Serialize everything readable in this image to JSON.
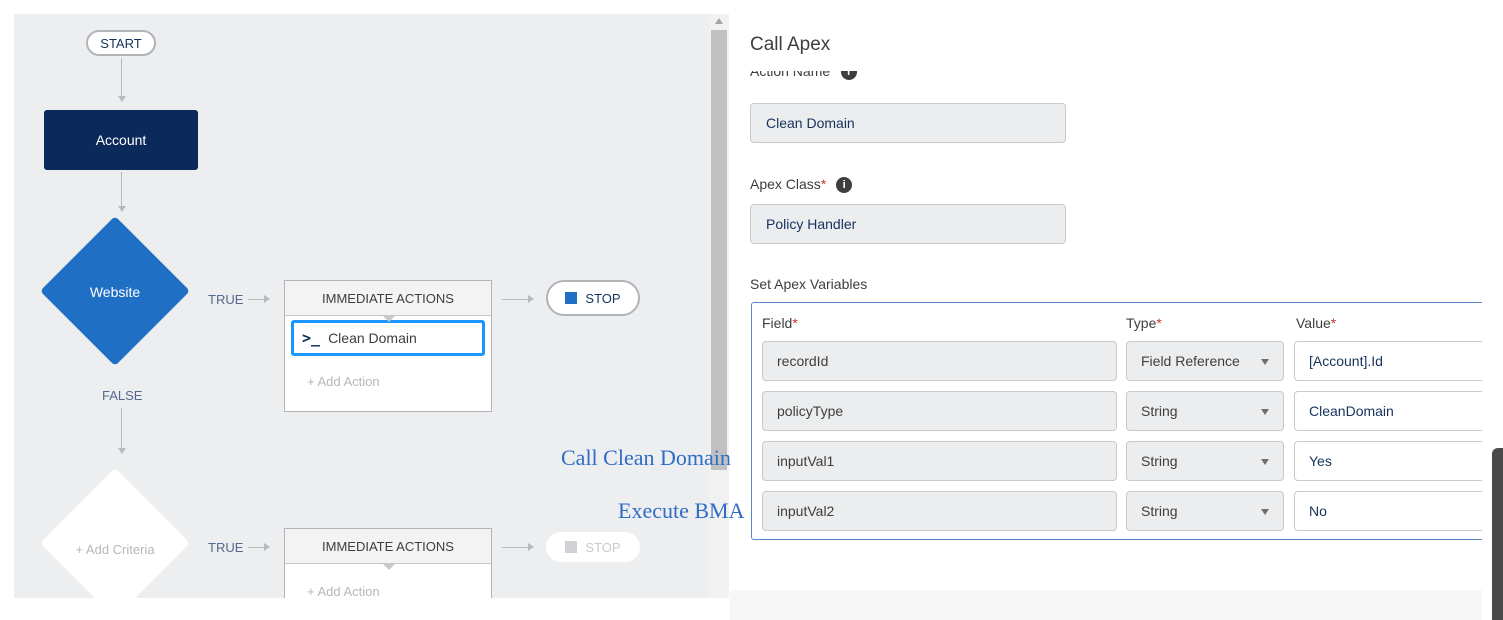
{
  "flow": {
    "start_label": "START",
    "object_label": "Account",
    "criteria1_label": "Website",
    "criteria2_label": "+ Add Criteria",
    "true_label": "TRUE",
    "false_label": "FALSE",
    "immediate_actions_label": "IMMEDIATE ACTIONS",
    "action_item_label": "Clean Domain",
    "add_action_label": "+ Add Action",
    "stop_label": "STOP"
  },
  "panel": {
    "title": "Call Apex",
    "action_name_label": "Action Name",
    "action_name_value": "Clean Domain",
    "apex_class_label": "Apex Class",
    "apex_class_value": "Policy Handler",
    "set_vars_label": "Set Apex Variables",
    "columns": {
      "field": "Field",
      "type": "Type",
      "value": "Value"
    },
    "rows": [
      {
        "field": "recordId",
        "type": "Field Reference",
        "value": "[Account].Id"
      },
      {
        "field": "policyType",
        "type": "String",
        "value": "CleanDomain"
      },
      {
        "field": "inputVal1",
        "type": "String",
        "value": "Yes"
      },
      {
        "field": "inputVal2",
        "type": "String",
        "value": "No"
      }
    ],
    "required_marker": "*",
    "info_glyph": "i"
  },
  "annotations": {
    "call_clean_domain": "Call Clean Domain",
    "execute_bma": "Execute BMA"
  },
  "colors": {
    "object_bg": "#0b2a5b",
    "criteria_bg": "#1f6fc5",
    "selection_border": "#1b96ff",
    "annotation_text": "#2f6cc4",
    "required": "#c23934"
  }
}
